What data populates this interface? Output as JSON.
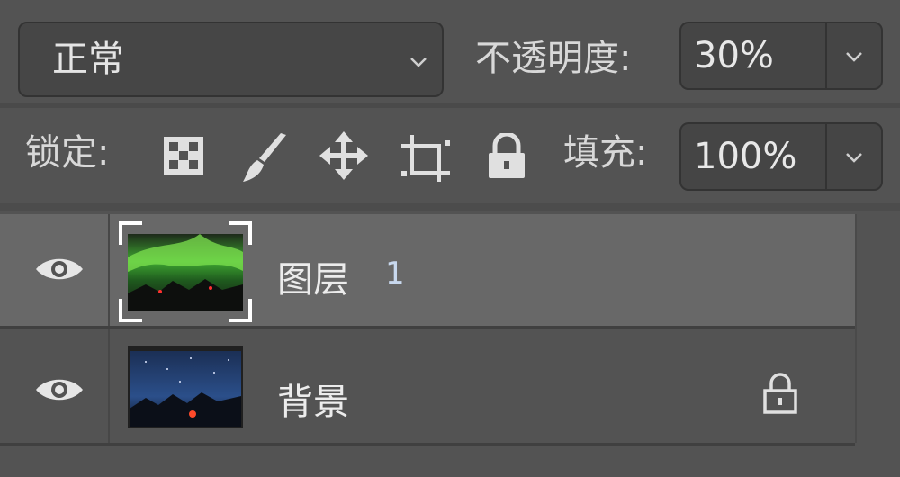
{
  "blend_mode": {
    "value": "正常",
    "icon": "chevron-down-icon"
  },
  "opacity": {
    "label": "不透明度:",
    "value": "30%"
  },
  "lock": {
    "label": "锁定:",
    "icons": [
      "lock-transparent-pixels-icon",
      "lock-image-pixels-brush-icon",
      "lock-position-move-icon",
      "lock-artboard-icon",
      "lock-all-icon"
    ]
  },
  "fill": {
    "label": "填充:",
    "value": "100%"
  },
  "layers": [
    {
      "name": "图层",
      "number": "1",
      "visible": true,
      "selected": true,
      "locked": false
    },
    {
      "name": "背景",
      "visible": true,
      "selected": false,
      "locked": true
    }
  ],
  "colors": {
    "panel": "#535353",
    "selected_row": "#686868",
    "field": "#454545",
    "border": "#333333"
  }
}
